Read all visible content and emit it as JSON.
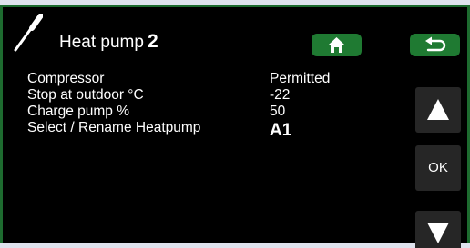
{
  "header": {
    "title": "Heat pump",
    "number": "2",
    "icon": "wrench-icon"
  },
  "toolbar": {
    "home_icon": "home-icon",
    "back_icon": "back-arrow-icon"
  },
  "settings": [
    {
      "label": "Compressor",
      "value": "Permitted"
    },
    {
      "label": "Stop at outdoor °C",
      "value": "-22"
    },
    {
      "label": "Charge pump %",
      "value": "50"
    },
    {
      "label": "Select / Rename Heatpump",
      "value": "A1"
    }
  ],
  "nav": {
    "up_icon": "arrow-up-icon",
    "ok_label": "OK",
    "down_icon": "arrow-down-icon"
  },
  "colors": {
    "accent": "#1f7a32",
    "frame": "#1d6b2f",
    "background": "#000000",
    "outer": "#dfe3ee"
  }
}
